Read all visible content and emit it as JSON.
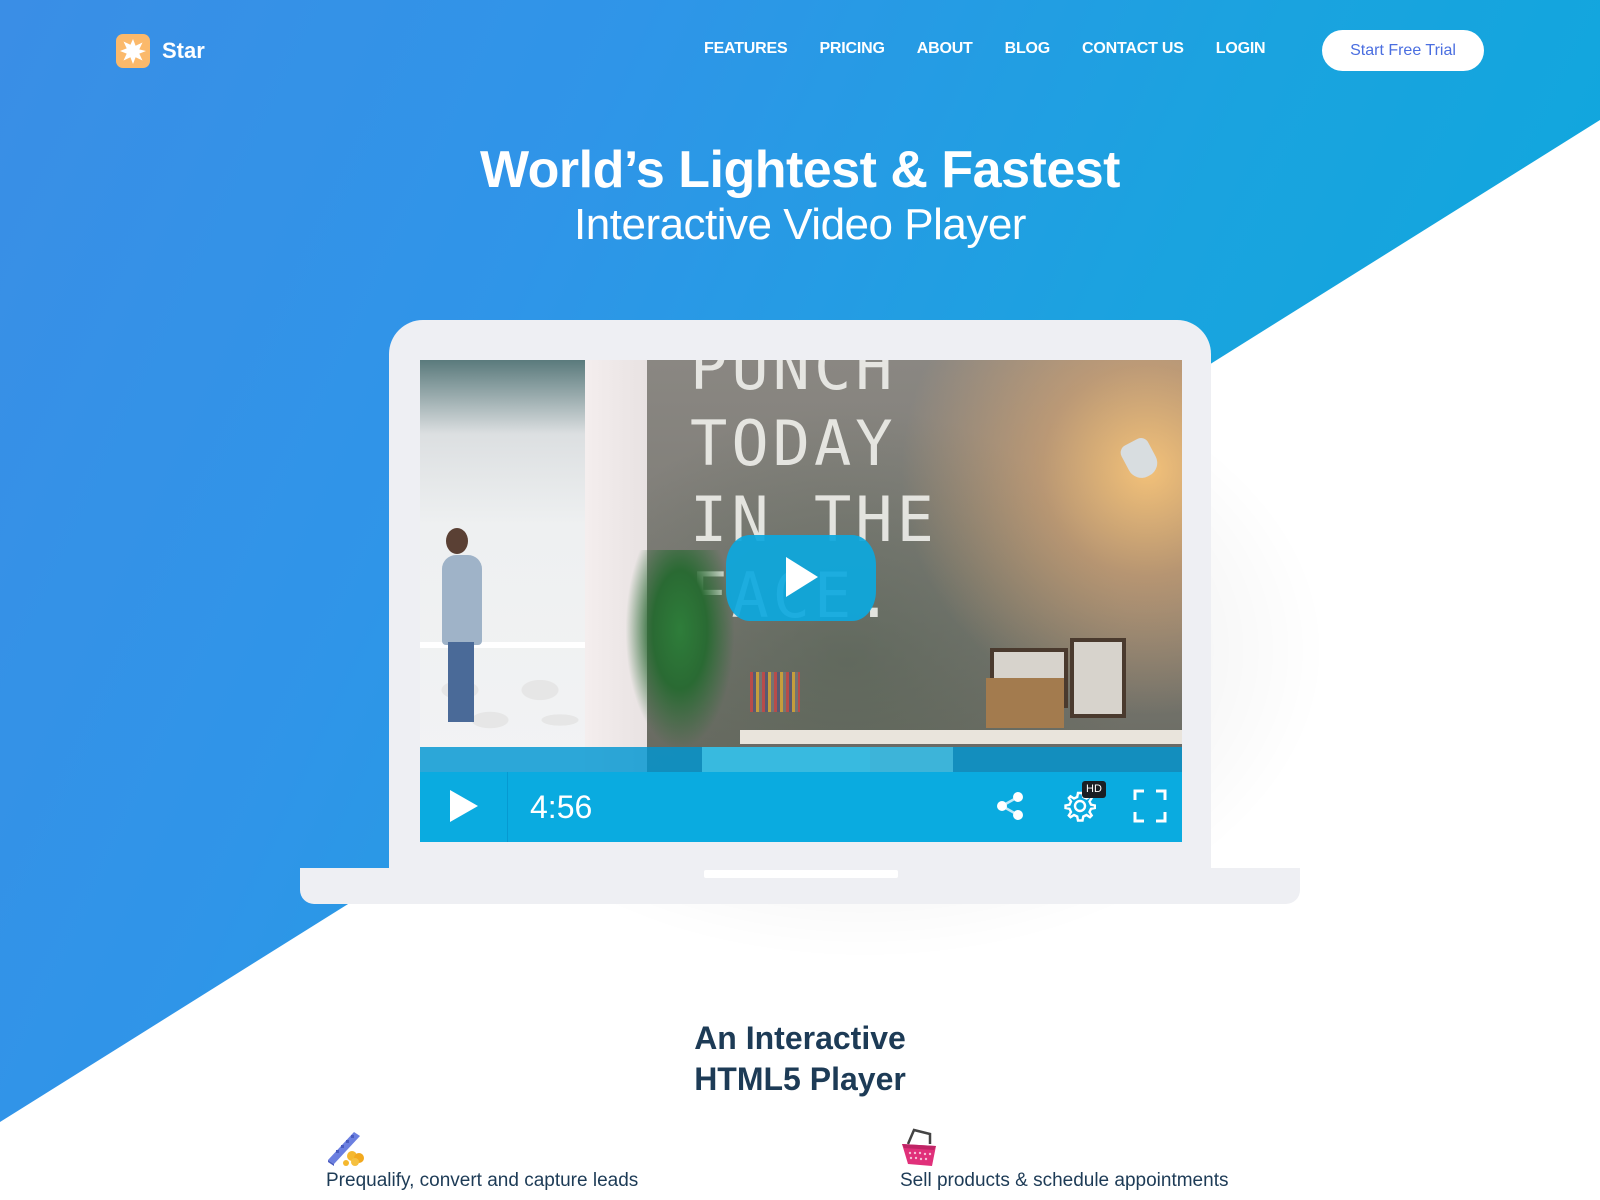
{
  "brand": {
    "name": "Star",
    "logo_icon": "star-burst-icon",
    "logo_color": "#fbb96b"
  },
  "nav": {
    "items": [
      {
        "label": "FEATURES"
      },
      {
        "label": "PRICING"
      },
      {
        "label": "ABOUT"
      },
      {
        "label": "BLOG"
      },
      {
        "label": "CONTACT US"
      },
      {
        "label": "LOGIN"
      }
    ],
    "cta_label": "Start Free Trial"
  },
  "hero": {
    "title": "World’s Lightest & Fastest",
    "subtitle": "Interactive Video Player"
  },
  "player": {
    "wall_text": "PUNCH\nTODAY\nIN THE\nFACE.",
    "time": "4:56",
    "hd_badge": "HD",
    "buffered_segments": [
      {
        "start": 0.37,
        "end": 0.59
      },
      {
        "start": 0.59,
        "end": 0.7
      }
    ],
    "icons": {
      "big_play": "play-icon",
      "play": "play-icon",
      "share": "share-icon",
      "settings": "gear-icon",
      "fullscreen": "fullscreen-icon"
    },
    "accent_color": "#0aabe0"
  },
  "section": {
    "title_line1": "An Interactive",
    "title_line2": "HTML5 Player"
  },
  "features": [
    {
      "icon": "conveyor-coins-icon",
      "text": "Prequalify, convert and capture leads"
    },
    {
      "icon": "shopping-basket-icon",
      "text": "Sell products & schedule appointments"
    }
  ],
  "colors": {
    "gradient_start": "#3a8ee6",
    "gradient_end": "#07aadb",
    "heading_dark": "#1d3b56",
    "cta_text": "#4a6ee0"
  }
}
